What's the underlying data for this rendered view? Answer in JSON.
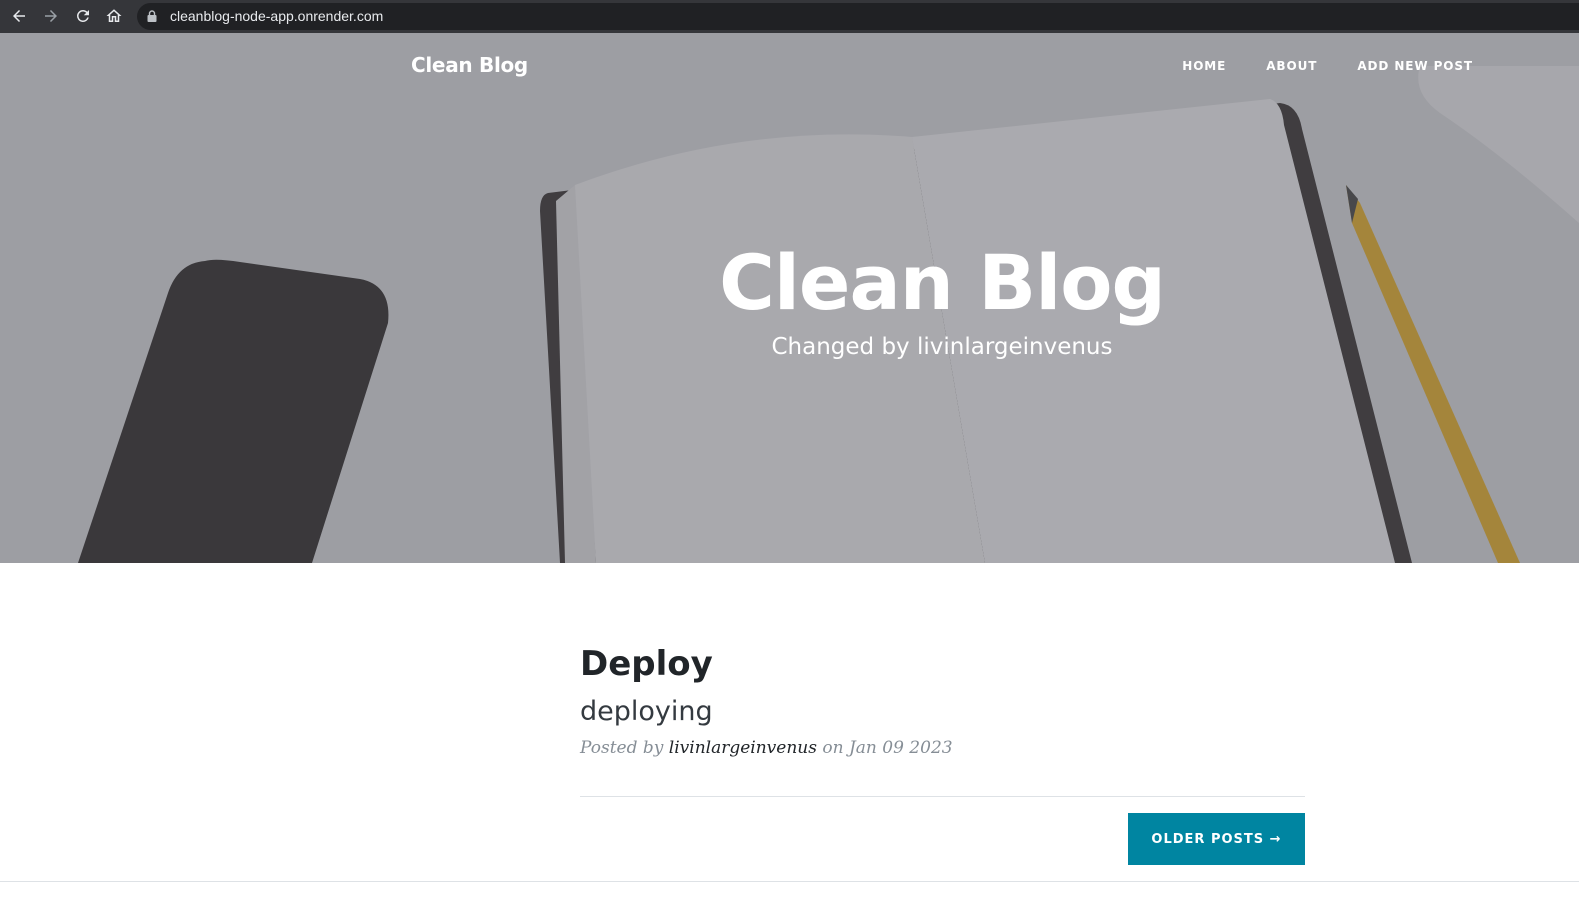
{
  "browser": {
    "url": "cleanblog-node-app.onrender.com",
    "back_icon": "arrow-left-icon",
    "forward_icon": "arrow-right-icon",
    "reload_icon": "reload-icon",
    "home_icon": "home-icon",
    "lock_icon": "lock-icon"
  },
  "navbar": {
    "brand": "Clean Blog",
    "links": [
      {
        "label": "HOME"
      },
      {
        "label": "ABOUT"
      },
      {
        "label": "ADD NEW POST"
      }
    ]
  },
  "header": {
    "title": "Clean Blog",
    "subtitle": "Changed by livinlargeinvenus"
  },
  "posts": [
    {
      "title": "Deploy",
      "subtitle": "deploying",
      "meta_prefix": "Posted by",
      "author": "livinlargeinvenus",
      "meta_on": "on",
      "date": "Jan 09 2023"
    }
  ],
  "pager": {
    "older_label": "OLDER POSTS →"
  },
  "colors": {
    "accent": "#0085a1",
    "heading": "#212529",
    "meta": "#868e96",
    "browser_bar": "#35363a",
    "address_bar": "#202124"
  }
}
